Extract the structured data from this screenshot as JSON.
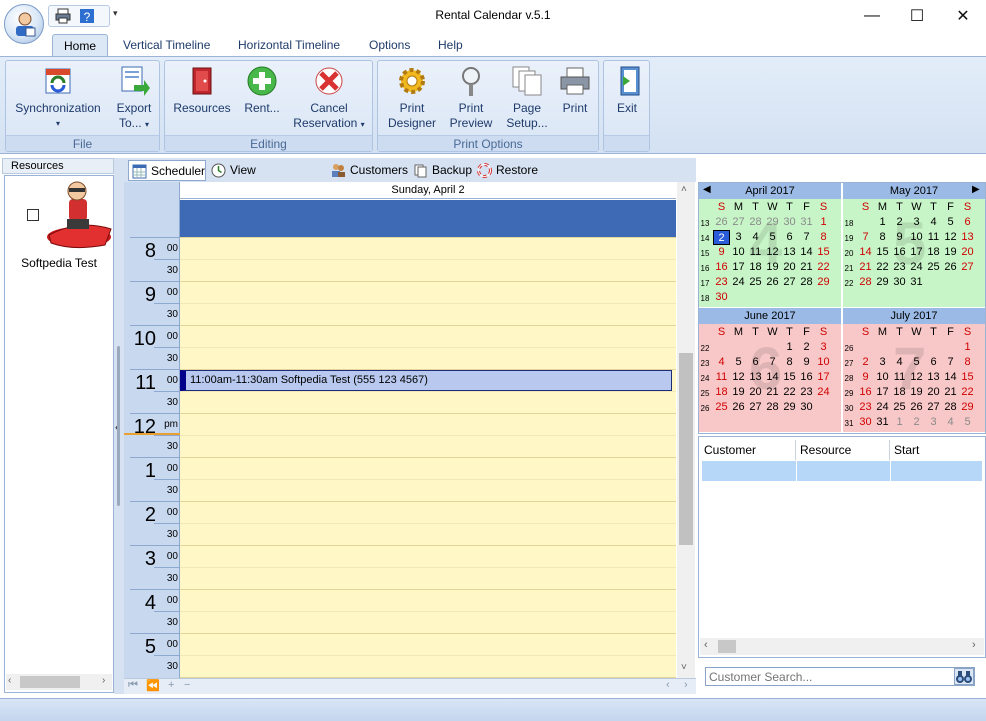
{
  "window": {
    "title": "Rental Calendar v.5.1",
    "minimize": "—",
    "maximize": "☐",
    "close": "✕",
    "qat_dropdown": "▾"
  },
  "ribbon_tabs": [
    "Home",
    "Vertical Timeline",
    "Horizontal Timeline",
    "Options",
    "Help"
  ],
  "ribbon": {
    "groups": {
      "file": "File",
      "editing": "Editing",
      "print_options": "Print Options"
    },
    "buttons": {
      "synchronization": "Synchronization",
      "export": "Export",
      "export2": "To...",
      "resources": "Resources",
      "rent": "Rent...",
      "cancel1": "Cancel",
      "cancel2": "Reservation",
      "print_designer1": "Print",
      "print_designer2": "Designer",
      "print_preview1": "Print",
      "print_preview2": "Preview",
      "page_setup1": "Page",
      "page_setup2": "Setup...",
      "print": "Print",
      "exit": "Exit"
    }
  },
  "resources_panel": {
    "header": "Resources",
    "items": [
      {
        "label": "Softpedia Test"
      }
    ]
  },
  "sub_tabs": [
    "Scheduler",
    "View Reservations",
    "Customers",
    "Backup",
    "Restore"
  ],
  "scheduler": {
    "date": "Sunday, April 2",
    "times": [
      {
        "h": "8",
        "m": "00"
      },
      {
        "h": "9",
        "m": "00"
      },
      {
        "h": "10",
        "m": "00"
      },
      {
        "h": "11",
        "m": "00"
      },
      {
        "h": "12",
        "m": "pm"
      },
      {
        "h": "1",
        "m": "00"
      },
      {
        "h": "2",
        "m": "00"
      },
      {
        "h": "3",
        "m": "00"
      },
      {
        "h": "4",
        "m": "00"
      },
      {
        "h": "5",
        "m": "00"
      }
    ],
    "half": "30",
    "appointment": "11:00am-11:30am Softpedia Test (555 123 4567)"
  },
  "calendar": {
    "months": [
      {
        "name": "April 2017",
        "big": "4",
        "weeks": [
          "13",
          "14",
          "15",
          "16",
          "17",
          "18"
        ],
        "days": [
          [
            "26",
            "27",
            "28",
            "29",
            "30",
            "31",
            "1"
          ],
          [
            "2",
            "3",
            "4",
            "5",
            "6",
            "7",
            "8"
          ],
          [
            "9",
            "10",
            "11",
            "12",
            "13",
            "14",
            "15"
          ],
          [
            "16",
            "17",
            "18",
            "19",
            "20",
            "21",
            "22"
          ],
          [
            "23",
            "24",
            "25",
            "26",
            "27",
            "28",
            "29"
          ],
          [
            "30",
            "",
            "",
            "",
            "",
            "",
            ""
          ]
        ]
      },
      {
        "name": "May 2017",
        "big": "5",
        "weeks": [
          "18",
          "19",
          "20",
          "21",
          "22"
        ],
        "days": [
          [
            "",
            "1",
            "2",
            "3",
            "4",
            "5",
            "6"
          ],
          [
            "7",
            "8",
            "9",
            "10",
            "11",
            "12",
            "13"
          ],
          [
            "14",
            "15",
            "16",
            "17",
            "18",
            "19",
            "20"
          ],
          [
            "21",
            "22",
            "23",
            "24",
            "25",
            "26",
            "27"
          ],
          [
            "28",
            "29",
            "30",
            "31",
            "",
            "",
            ""
          ]
        ]
      },
      {
        "name": "June 2017",
        "big": "6",
        "weeks": [
          "22",
          "23",
          "24",
          "25",
          "26"
        ],
        "days": [
          [
            "",
            "",
            "",
            "",
            "1",
            "2",
            "3"
          ],
          [
            "4",
            "5",
            "6",
            "7",
            "8",
            "9",
            "10"
          ],
          [
            "11",
            "12",
            "13",
            "14",
            "15",
            "16",
            "17"
          ],
          [
            "18",
            "19",
            "20",
            "21",
            "22",
            "23",
            "24"
          ],
          [
            "25",
            "26",
            "27",
            "28",
            "29",
            "30",
            ""
          ]
        ]
      },
      {
        "name": "July 2017",
        "big": "7",
        "weeks": [
          "26",
          "27",
          "28",
          "29",
          "30",
          "31"
        ],
        "days": [
          [
            "",
            "",
            "",
            "",
            "",
            "",
            "1"
          ],
          [
            "2",
            "3",
            "4",
            "5",
            "6",
            "7",
            "8"
          ],
          [
            "9",
            "10",
            "11",
            "12",
            "13",
            "14",
            "15"
          ],
          [
            "16",
            "17",
            "18",
            "19",
            "20",
            "21",
            "22"
          ],
          [
            "23",
            "24",
            "25",
            "26",
            "27",
            "28",
            "29"
          ],
          [
            "30",
            "31",
            "1",
            "2",
            "3",
            "4",
            "5"
          ]
        ]
      }
    ],
    "dow": [
      "S",
      "M",
      "T",
      "W",
      "T",
      "F",
      "S"
    ],
    "selected_day": "2",
    "prev": "◀",
    "next": "▶"
  },
  "customer_list": {
    "columns": [
      "Customer",
      "Resource",
      "Start"
    ],
    "search_placeholder": "Customer Search..."
  },
  "colors": {
    "grid_bg": "#fff7c5",
    "allday": "#3e6ab5",
    "april_may_bg": "#c8f5c8",
    "june_july_bg": "#f8c8c8",
    "weekend": "#d00000"
  }
}
